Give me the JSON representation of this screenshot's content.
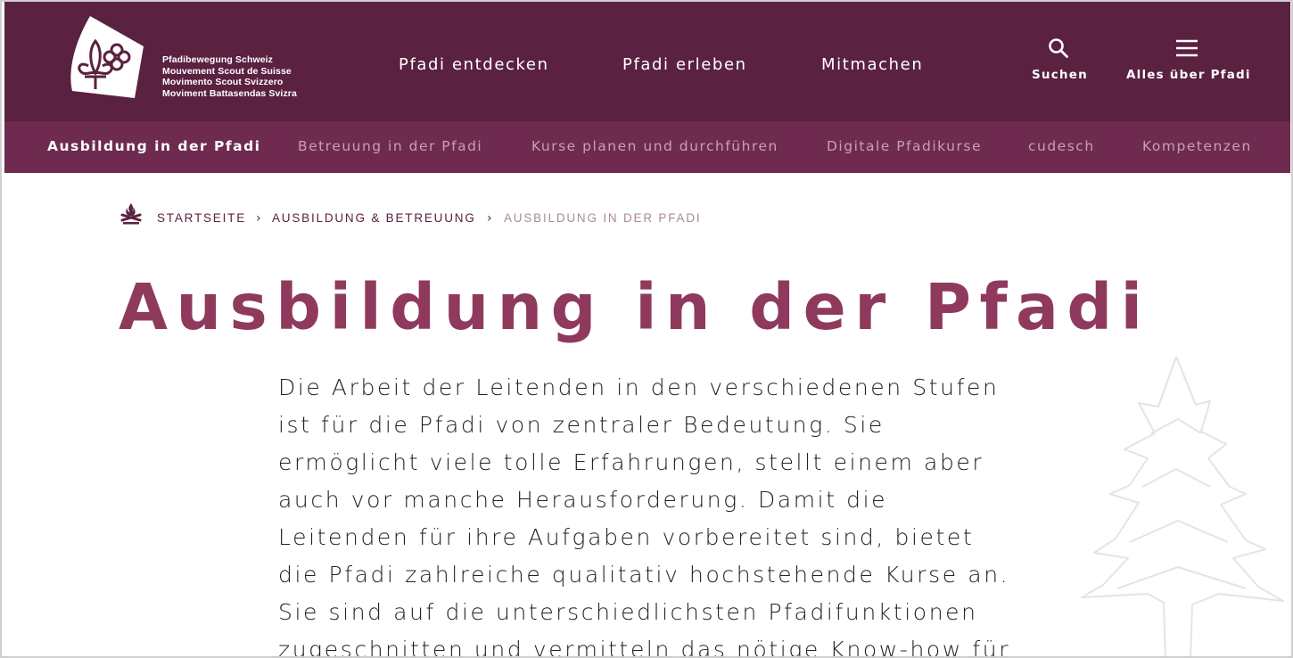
{
  "brand": {
    "lines": [
      "Pfadibewegung Schweiz",
      "Mouvement Scout de Suisse",
      "Movimento Scout Svizzero",
      "Moviment Battasendas Svizra"
    ]
  },
  "main_nav": [
    {
      "label": "Pfadi entdecken"
    },
    {
      "label": "Pfadi erleben"
    },
    {
      "label": "Mitmachen"
    }
  ],
  "utility": {
    "search_label": "Suchen",
    "menu_label": "Alles über Pfadi"
  },
  "sub_nav": [
    {
      "label": "Ausbildung in der Pfadi",
      "active": true
    },
    {
      "label": "Betreuung in der Pfadi"
    },
    {
      "label": "Kurse planen und durchführen"
    },
    {
      "label": "Digitale Pfadikurse"
    },
    {
      "label": "cudesch"
    },
    {
      "label": "Kompetenzen"
    }
  ],
  "breadcrumb": [
    {
      "label": "STARTSEITE"
    },
    {
      "label": "AUSBILDUNG & BETREUUNG"
    },
    {
      "label": "AUSBILDUNG IN DER PFADI"
    }
  ],
  "page": {
    "title": "Ausbildung in der Pfadi",
    "intro_lines": [
      "Die Arbeit der Leitenden in den verschiedenen Stufen",
      "ist für die Pfadi von zentraler Bedeutung. Sie",
      "ermöglicht viele tolle Erfahrungen, stellt einem aber",
      "auch vor manche Herausforderung. Damit die",
      "Leitenden für ihre Aufgaben vorbereitet sind, bietet",
      "die Pfadi zahlreiche qualitativ hochstehende Kurse an.",
      "Sie sind auf die unterschiedlichsten Pfadifunktionen",
      "zugeschnitten und vermitteln das nötige Know-how für"
    ]
  },
  "colors": {
    "header_bg": "#5a2140",
    "subnav_bg": "#6e2b4f",
    "title": "#8f3a5c",
    "subnav_inactive": "#c89fb5"
  },
  "icons": {
    "logo": "scout-lily-logo",
    "search": "search-icon",
    "menu": "hamburger-icon",
    "home": "campfire-icon",
    "separator": "chevron-right-icon",
    "decoration": "tree-outline"
  }
}
